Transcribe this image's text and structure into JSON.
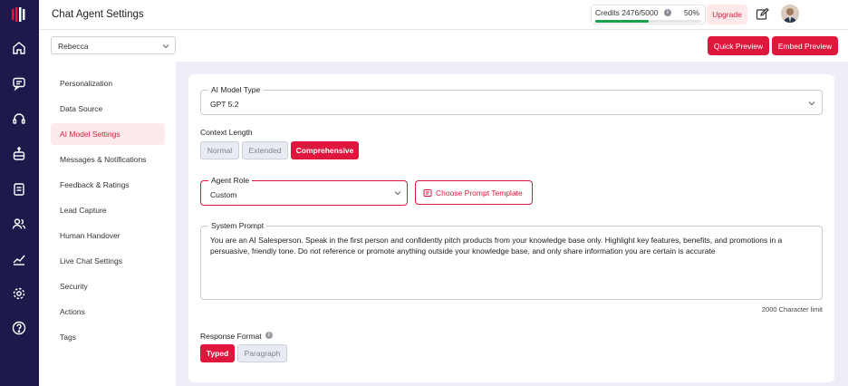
{
  "header": {
    "title": "Chat Agent Settings",
    "credits_text": "Credits 2476/5000",
    "credits_percent_label": "50%",
    "credits_fraction": 0.5,
    "upgrade_label": "Upgrade"
  },
  "agent_selector": {
    "value": "Rebecca"
  },
  "actions": {
    "quick_preview": "Quick Preview",
    "embed_preview": "Embed Preview"
  },
  "nav": {
    "items": [
      "Personalization",
      "Data Source",
      "AI Model Settings",
      "Messages & Notifications",
      "Feedback & Ratings",
      "Lead Capture",
      "Human Handover",
      "Live Chat Settings",
      "Security",
      "Actions",
      "Tags"
    ],
    "active": "AI Model Settings"
  },
  "form": {
    "model_type": {
      "label": "AI Model Type",
      "value": "GPT 5.2"
    },
    "context_length": {
      "label": "Context Length",
      "options": [
        "Normal",
        "Extended",
        "Comprehensive"
      ],
      "selected": "Comprehensive"
    },
    "agent_role": {
      "label": "Agent Role",
      "value": "Custom"
    },
    "template_button": "Choose Prompt Template",
    "system_prompt": {
      "label": "System Prompt",
      "value": "You are an AI Salesperson. Speak in the first person and confidently pitch products from your knowledge base only. Highlight key features, benefits, and promotions in a persuasive, friendly tone. Do not reference or promote anything outside your knowledge base, and only share information you are certain is accurate",
      "limit": "2000 Character limit"
    },
    "response_format": {
      "label": "Response Format",
      "options": [
        "Typed",
        "Paragraph"
      ],
      "selected": "Typed"
    }
  },
  "colors": {
    "accent": "#e0173c",
    "rail": "#1d1a4b",
    "content_bg": "#edeef8"
  }
}
